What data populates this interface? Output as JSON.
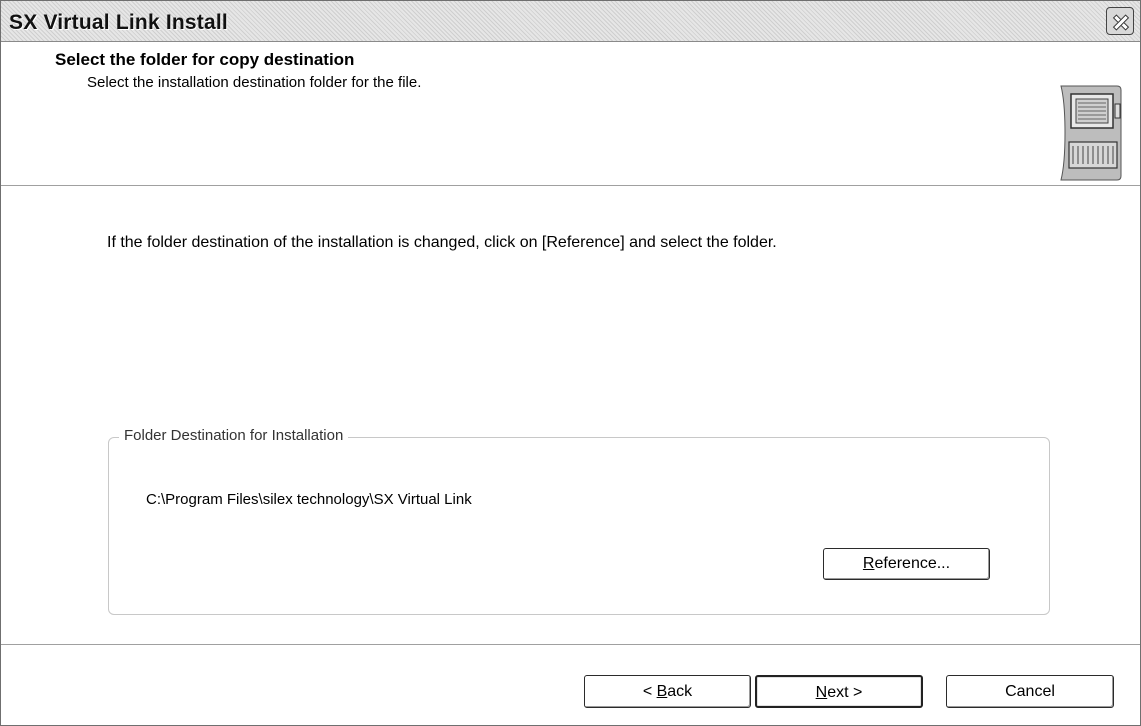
{
  "window": {
    "title": "SX Virtual Link Install"
  },
  "header": {
    "title": "Select the folder for copy destination",
    "subtitle": "Select the installation destination folder for the file.",
    "logo_icon": "computer-monitor-icon"
  },
  "body": {
    "instruction": "If the folder destination of the installation is changed, click on [Reference] and select the folder.",
    "group": {
      "label": "Folder Destination for Installation",
      "path": "C:\\Program Files\\silex technology\\SX Virtual Link",
      "reference_button": {
        "accel": "R",
        "rest": "eference..."
      }
    }
  },
  "footer": {
    "back_button": {
      "prefix": "< ",
      "accel": "B",
      "rest": "ack"
    },
    "next_button": {
      "accel": "N",
      "rest": "ext >"
    },
    "cancel_button": {
      "label": "Cancel"
    }
  },
  "icons": {
    "close": "close-icon"
  }
}
